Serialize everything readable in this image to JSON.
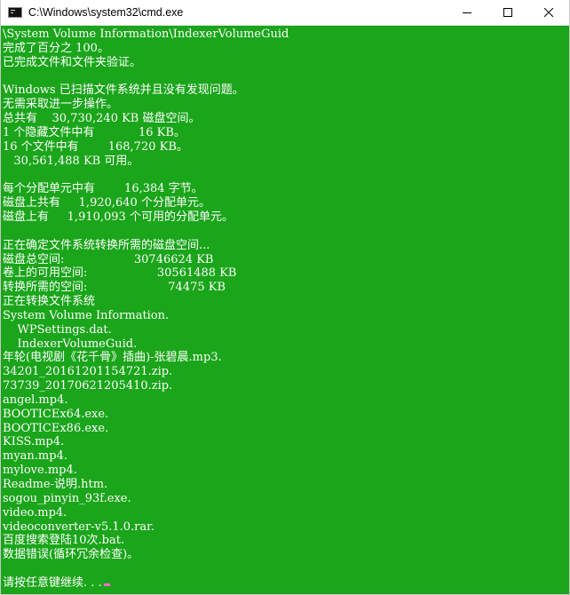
{
  "window": {
    "title": "C:\\Windows\\system32\\cmd.exe",
    "icon": "cmd-console-icon",
    "controls": {
      "minimize": "minimize-icon",
      "maximize": "maximize-icon",
      "close": "close-icon"
    },
    "colors": {
      "console_background": "#1aa51a",
      "console_text": "#ffffff",
      "cursor": "#ff6ad5"
    }
  },
  "console": {
    "lines": [
      "\\System Volume Information\\IndexerVolumeGuid",
      "完成了百分之 100。",
      "已完成文件和文件夹验证。",
      "",
      "Windows 已扫描文件系统并且没有发现问题。",
      "无需采取进一步操作。",
      "总共有    30,730,240 KB 磁盘空间。",
      "1 个隐藏文件中有            16 KB。",
      "16 个文件中有        168,720 KB。",
      "   30,561,488 KB 可用。",
      "",
      "每个分配单元中有        16,384 字节。",
      "磁盘上共有     1,920,640 个分配单元。",
      "磁盘上有     1,910,093 个可用的分配单元。",
      "",
      "正在确定文件系统转换所需的磁盘空间...",
      "磁盘总空间:                   30746624 KB",
      "卷上的可用空间:                   30561488 KB",
      "转换所需的空间:                      74475 KB",
      "正在转换文件系统",
      "System Volume Information.",
      "    WPSettings.dat.",
      "    IndexerVolumeGuid.",
      "年轮(电视剧《花千骨》插曲)-张碧晨.mp3.",
      "34201_20161201154721.zip.",
      "73739_20170621205410.zip.",
      "angel.mp4.",
      "BOOTICEx64.exe.",
      "BOOTICEx86.exe.",
      "KISS.mp4.",
      "myan.mp4.",
      "mylove.mp4.",
      "Readme-说明.htm.",
      "sogou_pinyin_93f.exe.",
      "video.mp4.",
      "videoconverter-v5.1.0.rar.",
      "百度搜索登陆10次.bat.",
      "数据错误(循环冗余检查)。",
      "",
      "请按任意键继续. . ."
    ]
  }
}
